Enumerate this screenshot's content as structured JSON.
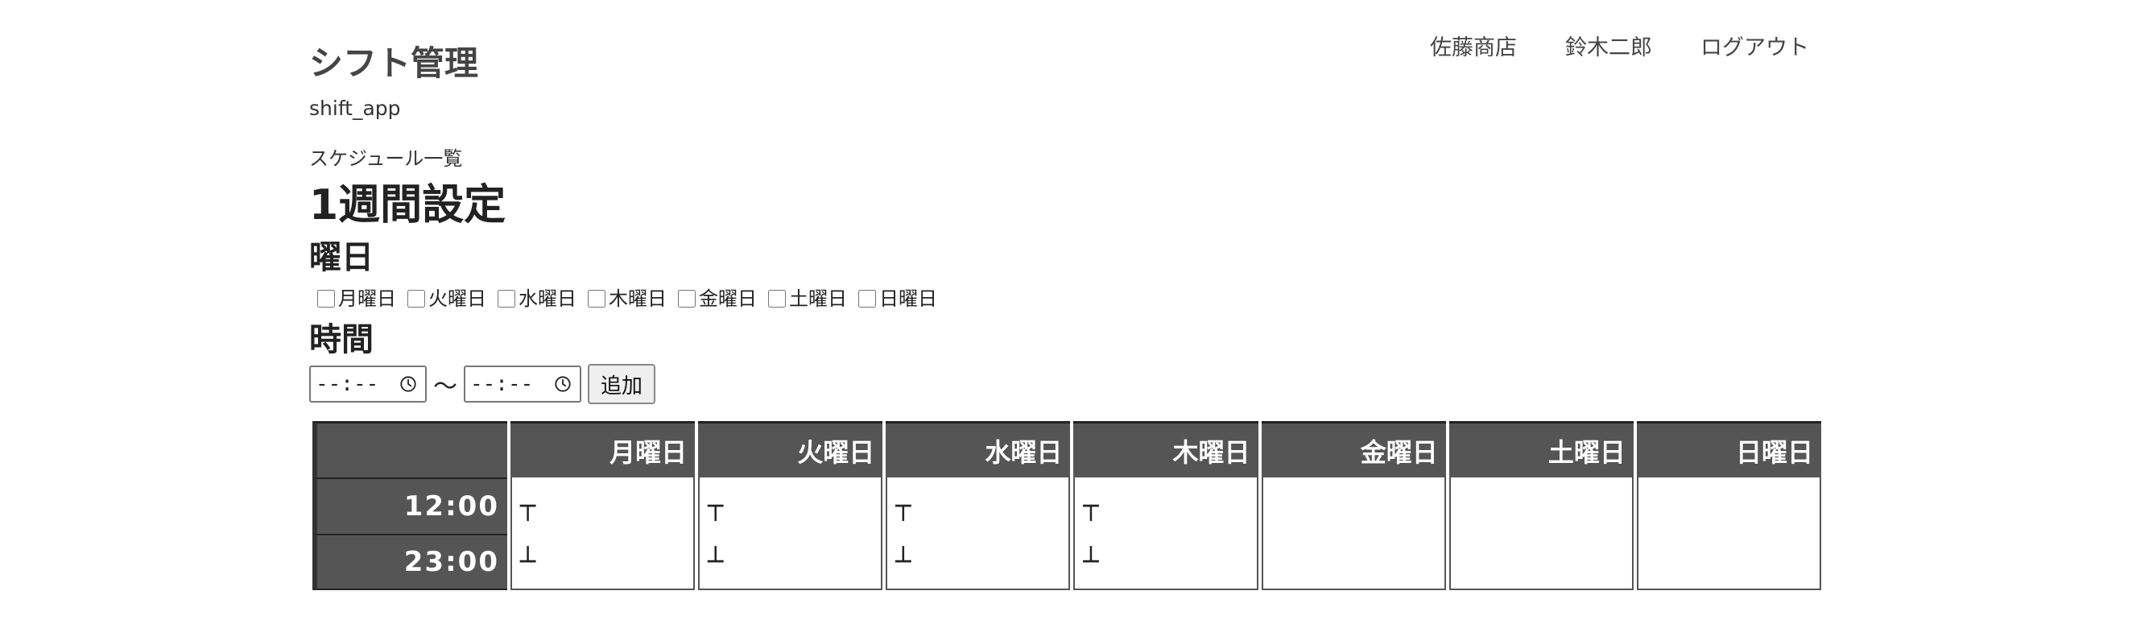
{
  "app": {
    "title": "シフト管理",
    "subtitle": "shift_app"
  },
  "nav": {
    "store": "佐藤商店",
    "user": "鈴木二郎",
    "logout": "ログアウト"
  },
  "breadcrumb": "スケジュール一覧",
  "page_title": "1週間設定",
  "days_section": {
    "label": "曜日",
    "options": [
      {
        "label": "月曜日",
        "checked": false
      },
      {
        "label": "火曜日",
        "checked": false
      },
      {
        "label": "水曜日",
        "checked": false
      },
      {
        "label": "木曜日",
        "checked": false
      },
      {
        "label": "金曜日",
        "checked": false
      },
      {
        "label": "土曜日",
        "checked": false
      },
      {
        "label": "日曜日",
        "checked": false
      }
    ]
  },
  "time_section": {
    "label": "時間",
    "start_value": "--:--",
    "end_value": "--:--",
    "separator": "〜",
    "add_label": "追加"
  },
  "schedule": {
    "columns": [
      "月曜日",
      "火曜日",
      "水曜日",
      "木曜日",
      "金曜日",
      "土曜日",
      "日曜日"
    ],
    "rows": [
      {
        "time": "12:00",
        "cells": [
          "┬",
          "┬",
          "┬",
          "┬",
          "",
          "",
          ""
        ]
      },
      {
        "time": "23:00",
        "cells": [
          "┴",
          "┴",
          "┴",
          "┴",
          "",
          "",
          ""
        ]
      }
    ]
  },
  "colors": {
    "header_bg": "#555555",
    "header_text": "#ffffff"
  }
}
